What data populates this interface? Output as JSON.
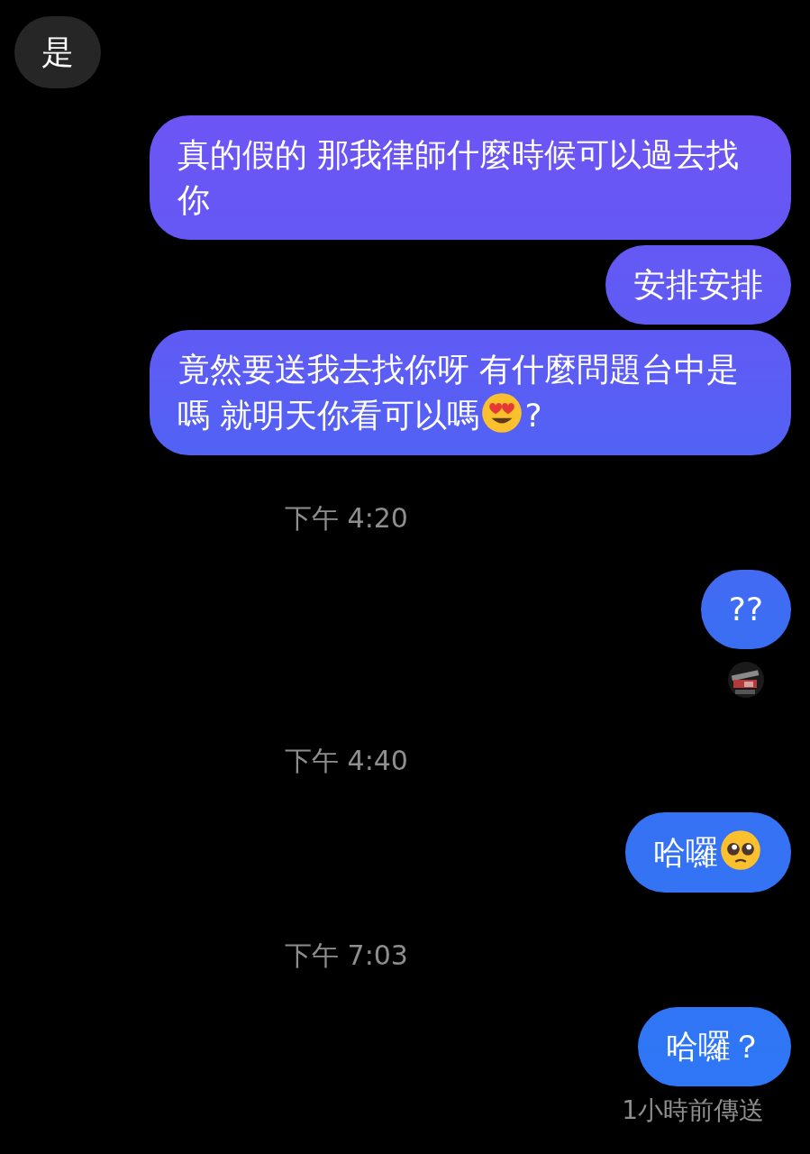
{
  "messages": [
    {
      "kind": "received",
      "parts": [
        {
          "kind": "text",
          "text": "是"
        }
      ]
    },
    {
      "kind": "sent",
      "parts": [
        {
          "kind": "text",
          "text": "真的假的 那我律師什麼時候可以過去找你"
        }
      ]
    },
    {
      "kind": "sent",
      "parts": [
        {
          "kind": "text",
          "text": "安排安排"
        }
      ]
    },
    {
      "kind": "sent",
      "parts": [
        {
          "kind": "text",
          "text": "竟然要送我去找你呀 有什麼問題台中是嗎 就明天你看可以嗎"
        },
        {
          "kind": "hearts"
        },
        {
          "kind": "text",
          "text": "?"
        }
      ]
    },
    {
      "kind": "time",
      "text": "下午 4:20"
    },
    {
      "kind": "sent",
      "parts": [
        {
          "kind": "text",
          "text": "??"
        }
      ]
    },
    {
      "kind": "seen_avatar"
    },
    {
      "kind": "time",
      "text": "下午 4:40"
    },
    {
      "kind": "sent",
      "parts": [
        {
          "kind": "text",
          "text": "哈囉"
        },
        {
          "kind": "pleading"
        }
      ]
    },
    {
      "kind": "time",
      "text": "下午 7:03"
    },
    {
      "kind": "sent",
      "parts": [
        {
          "kind": "text",
          "text": "哈囉？"
        }
      ]
    },
    {
      "kind": "status",
      "text": "1小時前傳送"
    }
  ]
}
